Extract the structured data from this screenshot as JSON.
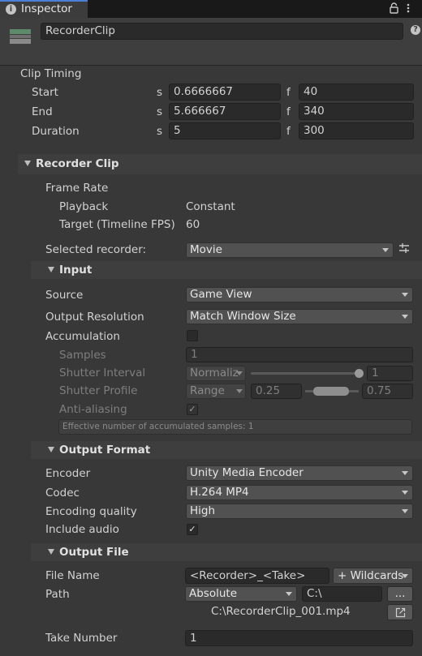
{
  "window": {
    "tab_title": "Inspector"
  },
  "header": {
    "object_name": "RecorderClip"
  },
  "clip_timing": {
    "title": "Clip Timing",
    "rows": [
      {
        "label": "Start",
        "s_unit": "s",
        "s_value": "0.6666667",
        "f_unit": "f",
        "f_value": "40"
      },
      {
        "label": "End",
        "s_unit": "s",
        "s_value": "5.666667",
        "f_unit": "f",
        "f_value": "340"
      },
      {
        "label": "Duration",
        "s_unit": "s",
        "s_value": "5",
        "f_unit": "f",
        "f_value": "300"
      }
    ]
  },
  "recorder_clip": {
    "title": "Recorder Clip",
    "frame_rate": {
      "label": "Frame Rate",
      "playback_label": "Playback",
      "playback_value": "Constant",
      "target_label": "Target (Timeline FPS)",
      "target_value": "60"
    },
    "selected_recorder": {
      "label": "Selected recorder:",
      "value": "Movie"
    }
  },
  "input": {
    "title": "Input",
    "source": {
      "label": "Source",
      "value": "Game View"
    },
    "output_resolution": {
      "label": "Output Resolution",
      "value": "Match Window Size"
    },
    "accumulation": {
      "label": "Accumulation",
      "checked": false
    },
    "samples": {
      "label": "Samples",
      "value": "1"
    },
    "shutter_interval": {
      "label": "Shutter Interval",
      "mode": "Normaliz",
      "value": "1",
      "slider_fraction": 1.0
    },
    "shutter_profile": {
      "label": "Shutter Profile",
      "mode": "Range",
      "min": "0.25",
      "max": "0.75"
    },
    "anti_aliasing": {
      "label": "Anti-aliasing",
      "checked": true
    },
    "info": "Effective number of accumulated samples: 1"
  },
  "output_format": {
    "title": "Output Format",
    "encoder": {
      "label": "Encoder",
      "value": "Unity Media Encoder"
    },
    "codec": {
      "label": "Codec",
      "value": "H.264 MP4"
    },
    "quality": {
      "label": "Encoding quality",
      "value": "High"
    },
    "include_audio": {
      "label": "Include audio",
      "checked": true
    }
  },
  "output_file": {
    "title": "Output File",
    "file_name": {
      "label": "File Name",
      "value": "<Recorder>_<Take>",
      "wildcards": "+ Wildcards"
    },
    "path": {
      "label": "Path",
      "mode": "Absolute",
      "value": "C:\\",
      "browse": "..."
    },
    "full_path": "C:\\RecorderClip_001.mp4",
    "take_number": {
      "label": "Take Number",
      "value": "1"
    }
  },
  "icons": [
    "info-icon",
    "lock-icon",
    "more-menu-icon",
    "recorder-clip-icon",
    "help-icon",
    "preset-icon",
    "open-folder-icon"
  ]
}
